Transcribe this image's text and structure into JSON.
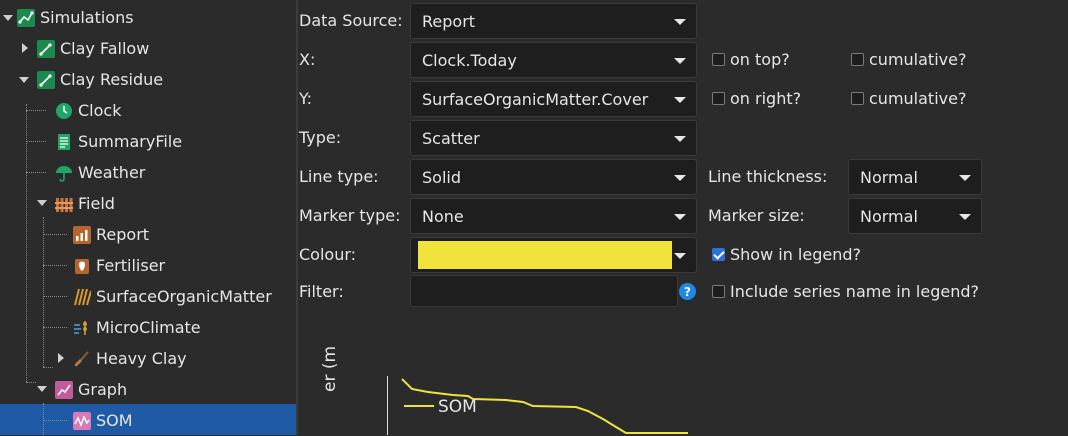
{
  "tree": {
    "items": [
      {
        "label": "Simulations"
      },
      {
        "label": "Clay Fallow"
      },
      {
        "label": "Clay Residue"
      },
      {
        "label": "Clock"
      },
      {
        "label": "SummaryFile"
      },
      {
        "label": "Weather"
      },
      {
        "label": "Field"
      },
      {
        "label": "Report"
      },
      {
        "label": "Fertiliser"
      },
      {
        "label": "SurfaceOrganicMatter"
      },
      {
        "label": "MicroClimate"
      },
      {
        "label": "Heavy Clay"
      },
      {
        "label": "Graph"
      },
      {
        "label": "SOM"
      }
    ]
  },
  "form": {
    "data_source_label": "Data Source:",
    "data_source_value": "Report",
    "x_label": "X:",
    "x_value": "Clock.Today",
    "x_on_top_label": "on top?",
    "x_cumulative_label": "cumulative?",
    "y_label": "Y:",
    "y_value": "SurfaceOrganicMatter.Cover",
    "y_on_right_label": "on right?",
    "y_cumulative_label": "cumulative?",
    "type_label": "Type:",
    "type_value": "Scatter",
    "line_type_label": "Line type:",
    "line_type_value": "Solid",
    "line_thickness_label": "Line thickness:",
    "line_thickness_value": "Normal",
    "marker_type_label": "Marker type:",
    "marker_type_value": "None",
    "marker_size_label": "Marker size:",
    "marker_size_value": "Normal",
    "colour_label": "Colour:",
    "colour_value": "#f0e43c",
    "show_in_legend_label": "Show in legend?",
    "show_in_legend_checked": true,
    "filter_label": "Filter:",
    "filter_value": "",
    "help_glyph": "?",
    "include_series_label": "Include series name in legend?"
  },
  "preview": {
    "ylabel_fragment": "er (m",
    "legend_label": "SOM",
    "line_color": "#f0e43c"
  }
}
